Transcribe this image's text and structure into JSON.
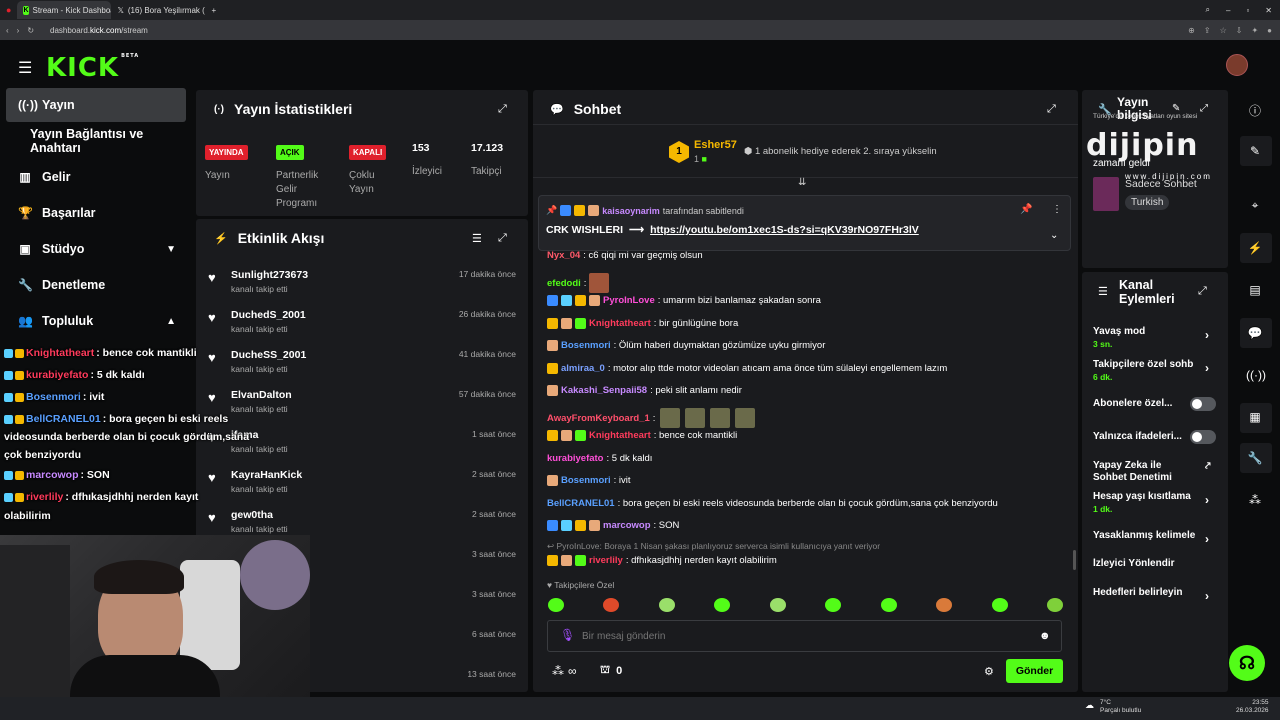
{
  "browser": {
    "tabs": [
      {
        "title": "Stream - Kick Dashboard",
        "active": true
      },
      {
        "title": "(16) Bora Yeşilırmak (@Bo",
        "active": false
      }
    ],
    "url_prefix": "dashboard.",
    "url_host": "kick.com",
    "url_path": "/stream"
  },
  "header": {
    "logo": "KICK",
    "logo_sup": "BETA"
  },
  "sidebar": {
    "items": [
      {
        "label": "Yayın",
        "icon": "broadcast-icon"
      },
      {
        "label": "Yayın Bağlantısı ve Anahtarı",
        "icon": ""
      },
      {
        "label": "Gelir",
        "icon": "chart-icon"
      },
      {
        "label": "Başarılar",
        "icon": "trophy-icon"
      },
      {
        "label": "Stüdyo",
        "icon": "studio-icon"
      },
      {
        "label": "Denetleme",
        "icon": "wrench-icon"
      },
      {
        "label": "Topluluk",
        "icon": "community-icon"
      }
    ]
  },
  "stats": {
    "title": "Yayın İstatistikleri",
    "badges": [
      {
        "badge": "YAYINDA",
        "label": "Yayın",
        "color": "#e0202c"
      },
      {
        "badge": "AÇIK",
        "label": "Partnerlik Gelir Programı",
        "color": "#53fc18"
      },
      {
        "badge": "KAPALI",
        "label": "Çoklu Yayın",
        "color": "#e0202c"
      }
    ],
    "numbers": [
      {
        "value": "153",
        "label": "İzleyici"
      },
      {
        "value": "17.123",
        "label": "Takipçi"
      }
    ]
  },
  "activity": {
    "title": "Etkinlik Akışı",
    "subtext": "kanalı takip etti",
    "rows": [
      {
        "name": "Sunlight273673",
        "time": "17 dakika önce"
      },
      {
        "name": "DuchedS_2001",
        "time": "26 dakika önce"
      },
      {
        "name": "DucheSS_2001",
        "time": "41 dakika önce"
      },
      {
        "name": "ElvanDalton",
        "time": "57 dakika önce"
      },
      {
        "name": "ifama",
        "time": "1 saat önce"
      },
      {
        "name": "KayraHanKick",
        "time": "2 saat önce"
      },
      {
        "name": "gew0tha",
        "time": "2 saat önce"
      },
      {
        "name": "",
        "time": "3 saat önce"
      },
      {
        "name": "",
        "time": "3 saat önce"
      },
      {
        "name": "",
        "time": "6 saat önce"
      },
      {
        "name": "",
        "time": "13 saat önce"
      }
    ]
  },
  "chat": {
    "title": "Sohbet",
    "gift_user": "Esher57",
    "gift_count": "1",
    "gift_text": "1 abonelik hediye ederek 2. sıraya yükselin",
    "pinned": {
      "by_user": "kaisaoynarim",
      "by_text": "tarafından sabitlendi",
      "text": "CRK WISHLERI",
      "arrow": "⟶",
      "link": "https://youtu.be/om1xec1S-ds?si=qKV39rNO97FHr3lV"
    },
    "messages": [
      {
        "user": "Nyx_04",
        "color": "#ff5a6a",
        "text": ": c6 qiqi mi var geçmiş olsun"
      },
      {
        "user": "efedodi",
        "color": "#53fc18",
        "text": ":"
      },
      {
        "user": "PyroInLove",
        "color": "#ff4fd8",
        "text": ": umarım bizi banlamaz şakadan sonra"
      },
      {
        "user": "Knightatheart",
        "color": "#ff3b5c",
        "text": ": bir günlügüne bora"
      },
      {
        "user": "Bosenmori",
        "color": "#5aa0ff",
        "text": ": Ölüm haberi duymaktan gözümüze uyku girmiyor"
      },
      {
        "user": "almiraa_0",
        "color": "#7aa0ff",
        "text": ": motor alıp ttde motor videoları atıcam ama önce tüm sülaleyi engellemem lazım"
      },
      {
        "user": "Kakashi_Senpaii58",
        "color": "#c78aff",
        "text": ": peki slit anlamı nedir"
      },
      {
        "user": "AwayFromKeyboard_1",
        "color": "#ff4f6b",
        "text": ":"
      },
      {
        "user": "Knightatheart",
        "color": "#ff3b5c",
        "text": ": bence cok mantikli"
      },
      {
        "user": "kurabiyefato",
        "color": "#ff4fd8",
        "text": ": 5 dk kaldı"
      },
      {
        "user": "Bosenmori",
        "color": "#5aa0ff",
        "text": ": ivit"
      },
      {
        "user": "BellCRANEL01",
        "color": "#5aa0ff",
        "text": ": bora geçen bi eski reels videosunda berberde olan bi çocuk gördüm,sana çok benziyordu"
      },
      {
        "user": "marcowop",
        "color": "#c78aff",
        "text": ": SON"
      },
      {
        "user": "riverlily",
        "color": "#ff3b5c",
        "text": ": dfhıkasjdhhj nerden kayıt olabilirim"
      }
    ],
    "reply_preview": "PyroInLove: Boraya 1 Nisan şakası planlıyoruz serverca isimli kullanıcıya yanıt veriyor",
    "followers_only": "Takipçilere Özel",
    "input_placeholder": "Bir mesaj gönderin",
    "points_value": "0",
    "infinity": "∞",
    "send_label": "Gönder"
  },
  "stream_info": {
    "title": "Yayın bilgisi",
    "ticker": "Türkiye'de köpek fiyatları oyun sitesi",
    "line1": "zamanı geldi",
    "category": "Sadece Sohbet",
    "tag": "Turkish",
    "watermark": "dijipin",
    "watermark_url": "www.dijipin.com"
  },
  "channel_actions": {
    "title": "Kanal Eylemleri",
    "items": [
      {
        "label": "Yavaş mod",
        "sub": "3 sn.",
        "kind": "arrow"
      },
      {
        "label": "Takipçilere özel sohb",
        "sub": "6 dk.",
        "kind": "arrow"
      },
      {
        "label": "Abonelere özel...",
        "sub": "",
        "kind": "toggle"
      },
      {
        "label": "Yalnızca ifadeleri...",
        "sub": "",
        "kind": "toggle"
      },
      {
        "label": "Yapay Zeka ile Sohbet Denetimi",
        "sub": "",
        "kind": "external"
      },
      {
        "label": "Hesap yaşı kısıtlama",
        "sub": "1 dk.",
        "kind": "arrow"
      },
      {
        "label": "Yasaklanmış kelimele",
        "sub": "",
        "kind": "arrow"
      },
      {
        "label": "İzleyici Yönlendir",
        "sub": "",
        "kind": "none"
      },
      {
        "label": "Hedefleri belirleyin",
        "sub": "",
        "kind": "arrow"
      }
    ]
  },
  "overlay_chat": [
    {
      "user": "Knightatheart",
      "color": "#ff3b5c",
      "text": ": bence cok mantikli"
    },
    {
      "user": "kurabiyefato",
      "color": "#ff3b5c",
      "text": ": 5 dk kaldı"
    },
    {
      "user": "Bosenmori",
      "color": "#5aa0ff",
      "text": ": ivit"
    },
    {
      "user": "BellCRANEL01",
      "color": "#5aa0ff",
      "text": ": bora geçen bi eski reels"
    },
    {
      "user": "",
      "color": "#fff",
      "text": "videosunda berberde olan bi çocuk gördüm,sana"
    },
    {
      "user": "",
      "color": "#fff",
      "text": "çok benziyordu"
    },
    {
      "user": "marcowop",
      "color": "#c78aff",
      "text": ": SON"
    },
    {
      "user": "riverlily",
      "color": "#ff3b5c",
      "text": ": dfhıkasjdhhj nerden kayıt"
    },
    {
      "user": "",
      "color": "#fff",
      "text": "olabilirim"
    }
  ],
  "taskbar": {
    "weather_temp": "7°C",
    "weather_text": "Parçalı bulutlu",
    "time": "23:55",
    "date": "26.03.2026"
  },
  "colors": {
    "brand": "#53fc18",
    "panel": "#1a1b1e",
    "live": "#e0202c"
  }
}
